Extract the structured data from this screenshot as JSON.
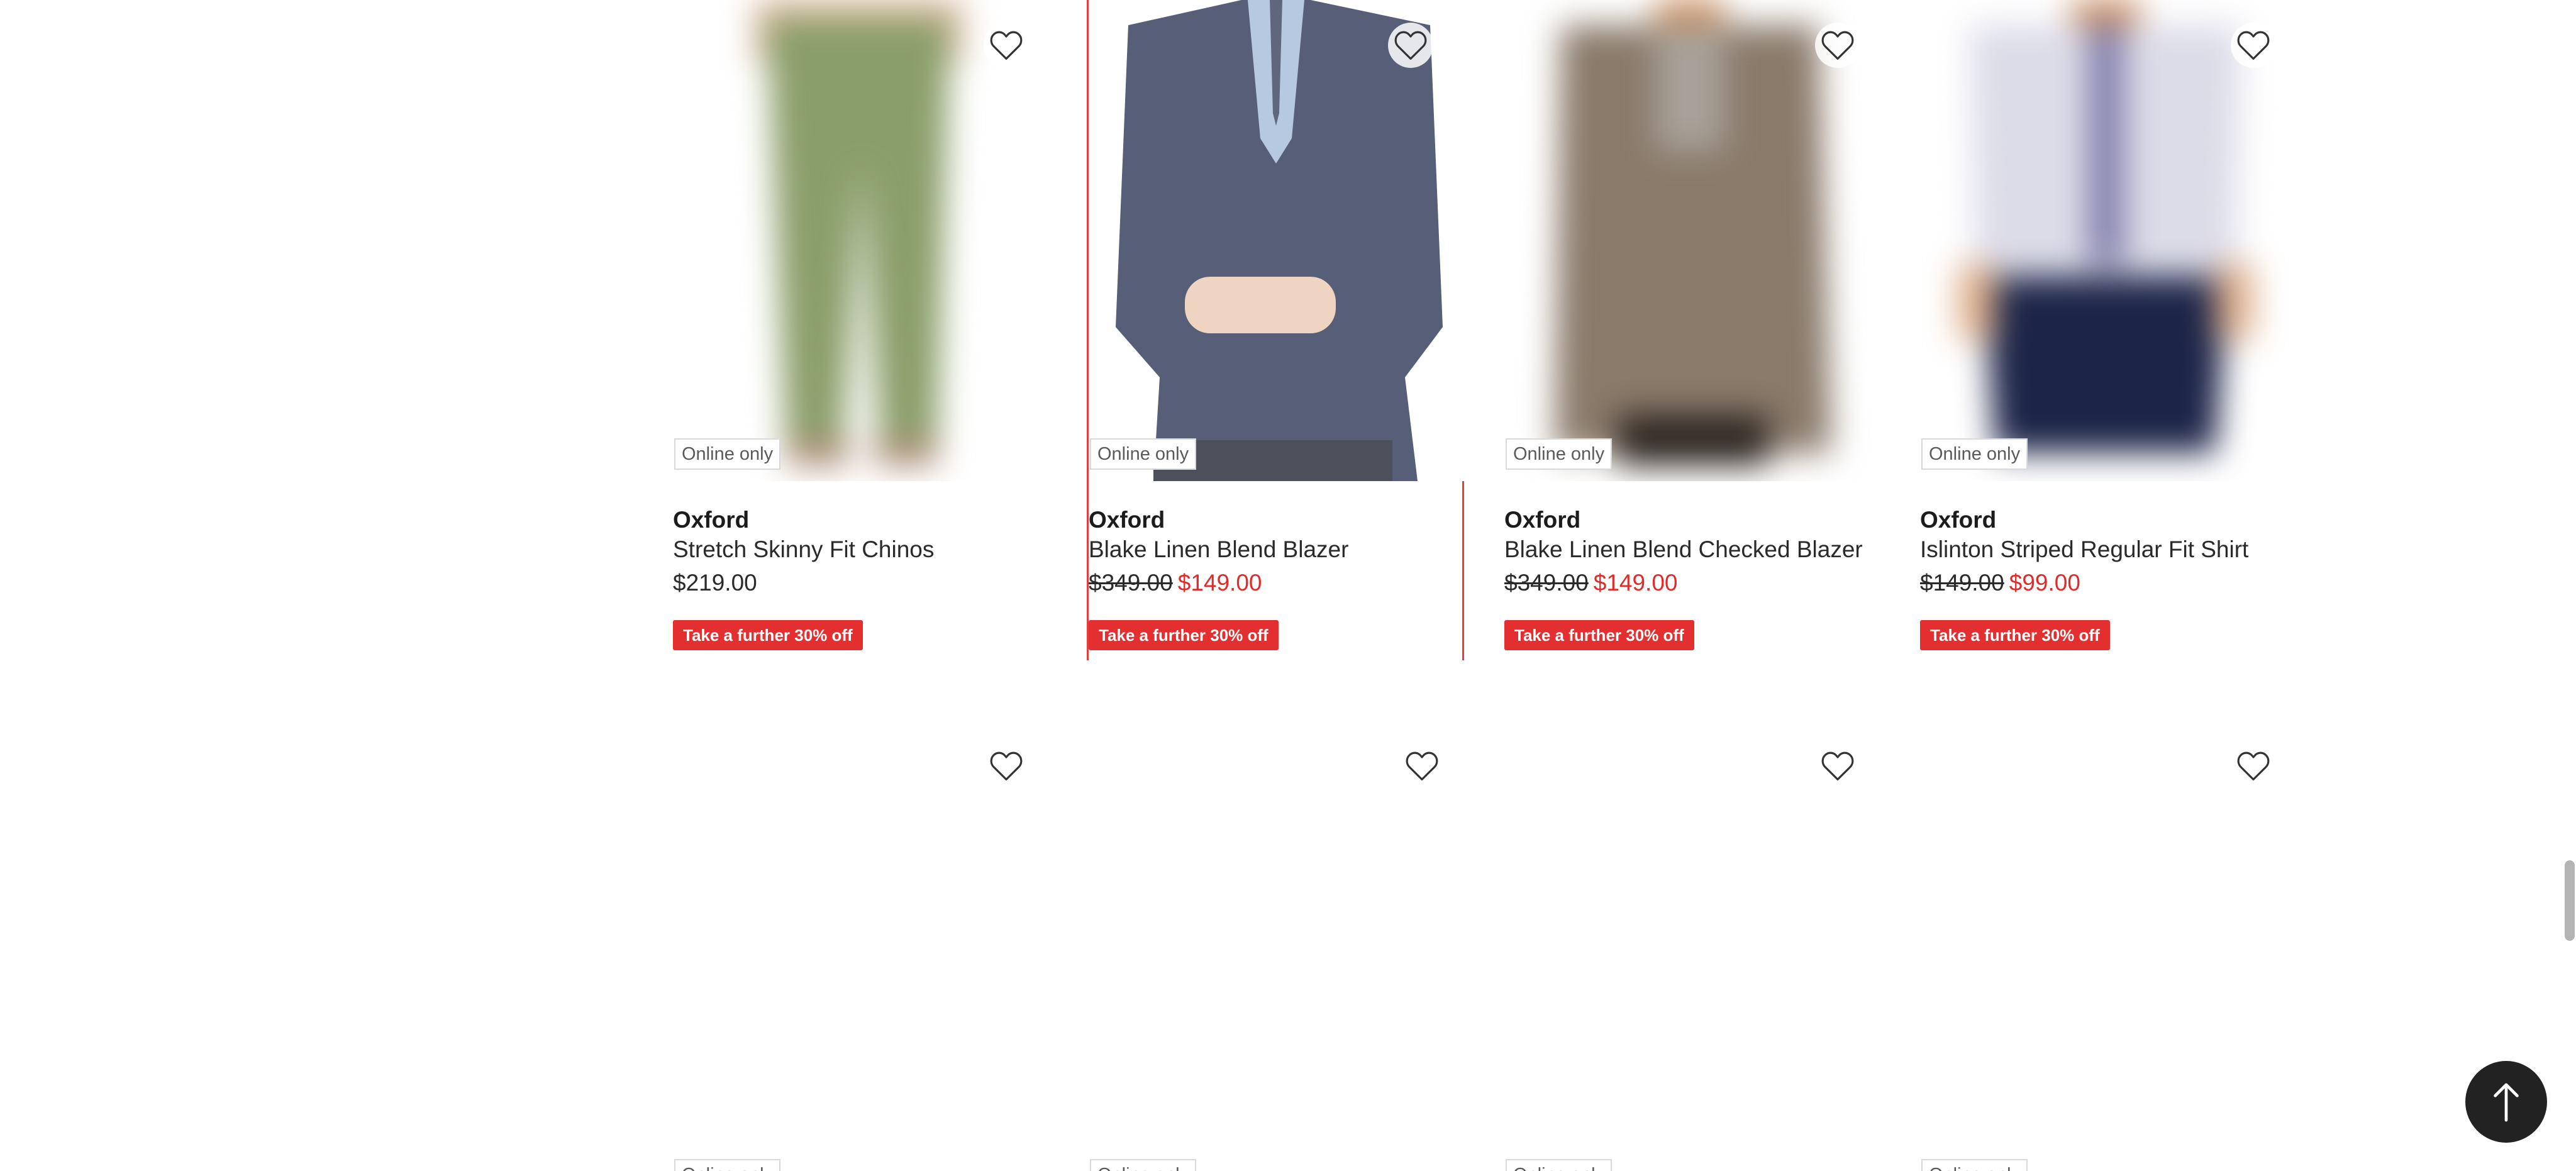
{
  "products_row1": [
    {
      "online_badge": "Online only",
      "brand": "Oxford",
      "name": "Stretch Skinny Fit Chinos",
      "regular_price": "$219.00",
      "promo": "Take a further 30% off",
      "favourite_icon": "heart-outline-icon"
    },
    {
      "online_badge": "Online only",
      "brand": "Oxford",
      "name": "Blake Linen Blend Blazer",
      "was_price": "$349.00",
      "now_price": "$149.00",
      "promo": "Take a further 30% off",
      "favourite_icon": "heart-outline-icon"
    },
    {
      "online_badge": "Online only",
      "brand": "Oxford",
      "name": "Blake Linen Blend Checked Blazer",
      "was_price": "$349.00",
      "now_price": "$149.00",
      "promo": "Take a further 30% off",
      "favourite_icon": "heart-outline-icon"
    },
    {
      "online_badge": "Online only",
      "brand": "Oxford",
      "name": "Islinton Striped Regular Fit Shirt",
      "was_price": "$149.00",
      "now_price": "$99.00",
      "promo": "Take a further 30% off",
      "favourite_icon": "heart-outline-icon"
    }
  ],
  "products_row2": [
    {
      "online_badge": "Online only",
      "favourite_icon": "heart-outline-icon"
    },
    {
      "online_badge": "Online only",
      "favourite_icon": "heart-outline-icon"
    },
    {
      "online_badge": "Online only",
      "favourite_icon": "heart-outline-icon"
    },
    {
      "online_badge": "Online only",
      "favourite_icon": "heart-outline-icon"
    }
  ],
  "back_to_top_icon": "arrow-up-icon",
  "colors": {
    "sale_price": "#e02b2b",
    "promo_bg": "#e32f2f",
    "hover_outline": "#e63c3c"
  }
}
